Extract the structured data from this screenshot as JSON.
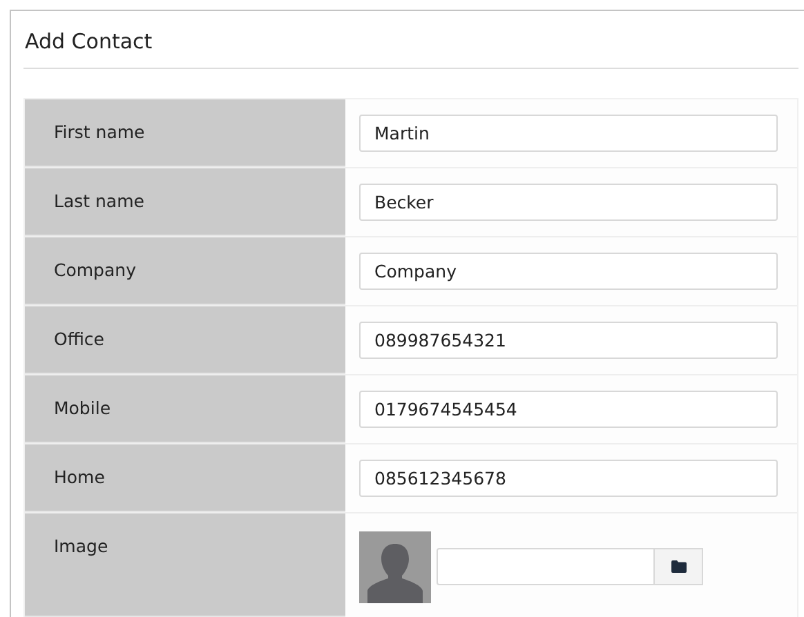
{
  "panel": {
    "title": "Add Contact"
  },
  "fields": [
    {
      "kind": "text",
      "label": "First name",
      "value": "Martin"
    },
    {
      "kind": "text",
      "label": "Last name",
      "value": "Becker"
    },
    {
      "kind": "text",
      "label": "Company",
      "value": "Company"
    },
    {
      "kind": "text",
      "label": "Office",
      "value": "089987654321"
    },
    {
      "kind": "text",
      "label": "Mobile",
      "value": "0179674545454"
    },
    {
      "kind": "text",
      "label": "Home",
      "value": "085612345678"
    },
    {
      "kind": "image",
      "label": "Image"
    }
  ]
}
